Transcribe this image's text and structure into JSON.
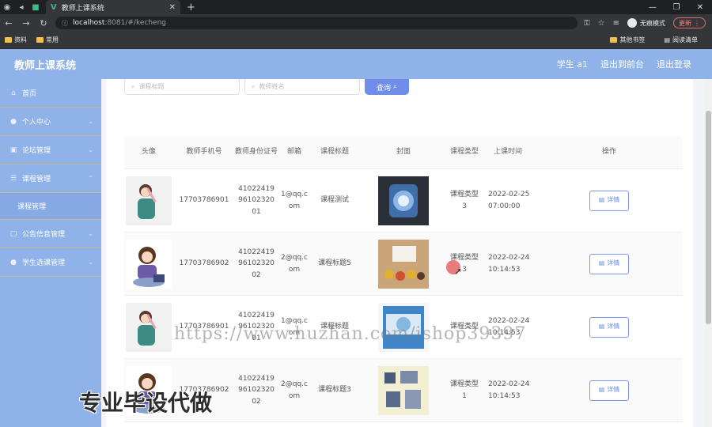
{
  "browser": {
    "tab_title": "教师上课系统",
    "url_host": "localhost",
    "url_path": ":8081/#/kecheng",
    "incognito_label": "无痕模式",
    "update_label": "更新",
    "bookmarks": [
      "资料",
      "常用"
    ],
    "bookmarks_right": [
      "其他书签",
      "阅读清单"
    ]
  },
  "header": {
    "app_title": "教师上课系统",
    "links": [
      "学生 a1",
      "退出到前台",
      "退出登录"
    ]
  },
  "sidebar": {
    "items": [
      {
        "label": "首页",
        "icon": "home-icon"
      },
      {
        "label": "个人中心",
        "icon": "user-icon"
      },
      {
        "label": "论坛管理",
        "icon": "forum-icon"
      },
      {
        "label": "课程管理",
        "icon": "list-icon"
      }
    ],
    "sub_item": "课程管理",
    "items_after": [
      {
        "label": "公告信息管理",
        "icon": "notice-icon"
      },
      {
        "label": "学生选课管理",
        "icon": "user-icon"
      }
    ]
  },
  "search": {
    "title_placeholder": "课程标题",
    "teacher_placeholder": "教师姓名",
    "button_label": "查询"
  },
  "table": {
    "headers": [
      "头像",
      "教师手机号",
      "教师身份证号",
      "邮箱",
      "课程标题",
      "封面",
      "课程类型",
      "上课时间",
      "操作"
    ],
    "rows": [
      {
        "phone": "17703786901",
        "id_card": "410224199610232001",
        "email": "1@qq.com",
        "title": "课程测试",
        "type": "课程类型3",
        "time": "2022-02-25 07:00:00",
        "action": "详情"
      },
      {
        "phone": "17703786902",
        "id_card": "410224199610232002",
        "email": "2@qq.com",
        "title": "课程标题5",
        "type": "课程类型3",
        "time": "2022-02-24 10:14:53",
        "action": "详情"
      },
      {
        "phone": "17703786901",
        "id_card": "410224199610232001",
        "email": "1@qq.com",
        "title": "课程标题",
        "type": "课程类型",
        "time": "2022-02-24 10:14:53",
        "action": "详情"
      },
      {
        "phone": "17703786902",
        "id_card": "410224199610232002",
        "email": "2@qq.com",
        "title": "课程标题3",
        "type": "课程类型1",
        "time": "2022-02-24 10:14:53",
        "action": "详情"
      }
    ]
  },
  "overlays": {
    "watermark": "https://www.huzhan.com/ishop39397",
    "promo": "专业毕设代做"
  },
  "colors": {
    "primary": "#8fb2e8",
    "button": "#6f8ee9"
  }
}
